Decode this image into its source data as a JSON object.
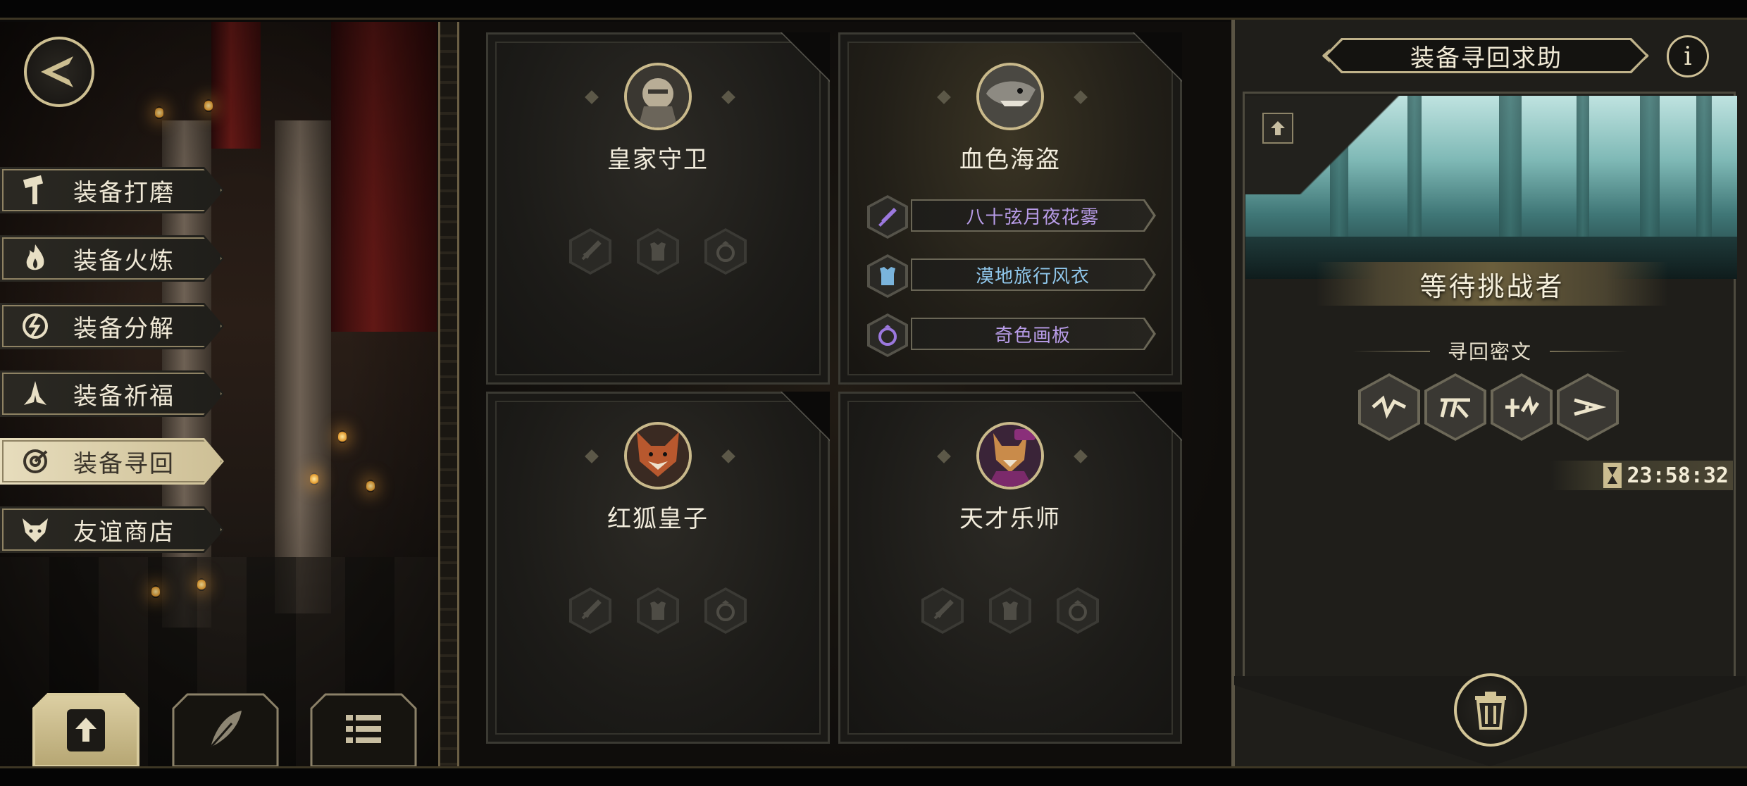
{
  "menu": {
    "items": [
      {
        "label": "装备打磨",
        "icon": "hammer-icon",
        "active": false
      },
      {
        "label": "装备火炼",
        "icon": "flame-icon",
        "active": false
      },
      {
        "label": "装备分解",
        "icon": "disassemble-icon",
        "active": false
      },
      {
        "label": "装备祈福",
        "icon": "praying-hands-icon",
        "active": false
      },
      {
        "label": "装备寻回",
        "icon": "retrieve-icon",
        "active": true
      },
      {
        "label": "友谊商店",
        "icon": "fox-shop-icon",
        "active": false
      }
    ]
  },
  "bottom_tabs": [
    {
      "icon": "upload-icon",
      "active": true
    },
    {
      "icon": "feather-icon",
      "active": false
    },
    {
      "icon": "list-icon",
      "active": false
    }
  ],
  "cards": [
    {
      "name": "皇家守卫",
      "portrait": "royal-guard-portrait",
      "equipment": []
    },
    {
      "name": "血色海盗",
      "portrait": "crimson-pirate-portrait",
      "equipment": [
        {
          "label": "八十弦月夜花雾",
          "icon": "sword-icon",
          "color": "#b89ce8"
        },
        {
          "label": "漠地旅行风衣",
          "icon": "armor-icon",
          "color": "#8fc6ea"
        },
        {
          "label": "奇色画板",
          "icon": "ring-icon",
          "color": "#b89ce8"
        }
      ]
    },
    {
      "name": "红狐皇子",
      "portrait": "red-fox-prince-portrait",
      "equipment": []
    },
    {
      "name": "天才乐师",
      "portrait": "genius-musician-portrait",
      "equipment": []
    }
  ],
  "right_panel": {
    "title": "装备寻回求助",
    "info": "i",
    "status": "等待挑战者",
    "cipher_label": "寻回密文",
    "runes": [
      "rune-1-icon",
      "rune-2-icon",
      "rune-3-icon",
      "rune-4-icon"
    ],
    "timer": "23:58:32"
  },
  "colors": {
    "gold": "#cdbf91",
    "panel": "#1f1e1a",
    "epic": "#b89ce8",
    "rare": "#8fc6ea"
  }
}
